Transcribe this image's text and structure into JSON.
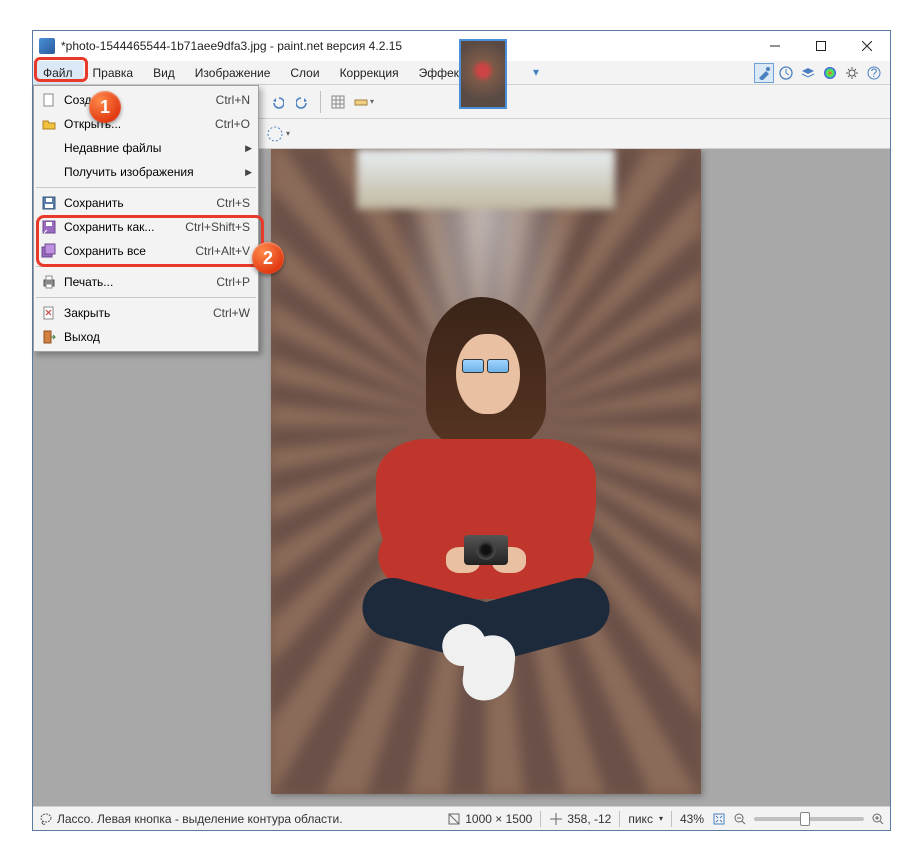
{
  "title": "*photo-1544465544-1b71aee9dfa3.jpg - paint.net версия 4.2.15",
  "menubar": [
    "Файл",
    "Правка",
    "Вид",
    "Изображение",
    "Слои",
    "Коррекция",
    "Эффекты"
  ],
  "right_toolbar_icons": [
    "tools-icon",
    "history-icon",
    "layers-icon",
    "colors-icon",
    "settings-icon",
    "help-icon"
  ],
  "dropdown": {
    "items": [
      {
        "icon": "new-icon",
        "label": "Создать...",
        "shortcut": "Ctrl+N"
      },
      {
        "icon": "open-icon",
        "label": "Открыть...",
        "shortcut": "Ctrl+O"
      },
      {
        "icon": "",
        "label": "Недавние файлы",
        "shortcut": "",
        "submenu": true
      },
      {
        "icon": "",
        "label": "Получить изображения",
        "shortcut": "",
        "submenu": true
      },
      {
        "sep": true
      },
      {
        "icon": "save-icon",
        "label": "Сохранить",
        "shortcut": "Ctrl+S"
      },
      {
        "icon": "saveas-icon",
        "label": "Сохранить как...",
        "shortcut": "Ctrl+Shift+S"
      },
      {
        "icon": "saveall-icon",
        "label": "Сохранить все",
        "shortcut": "Ctrl+Alt+V"
      },
      {
        "sep": true
      },
      {
        "icon": "print-icon",
        "label": "Печать...",
        "shortcut": "Ctrl+P"
      },
      {
        "sep": true
      },
      {
        "icon": "close-doc-icon",
        "label": "Закрыть",
        "shortcut": "Ctrl+W"
      },
      {
        "icon": "exit-icon",
        "label": "Выход",
        "shortcut": ""
      }
    ]
  },
  "status": {
    "hint": "Лассо. Левая кнопка - выделение контура области.",
    "size": "1000 × 1500",
    "cursor": "358, -12",
    "units": "пикс",
    "zoom": "43%"
  },
  "badges": {
    "one": "1",
    "two": "2"
  }
}
